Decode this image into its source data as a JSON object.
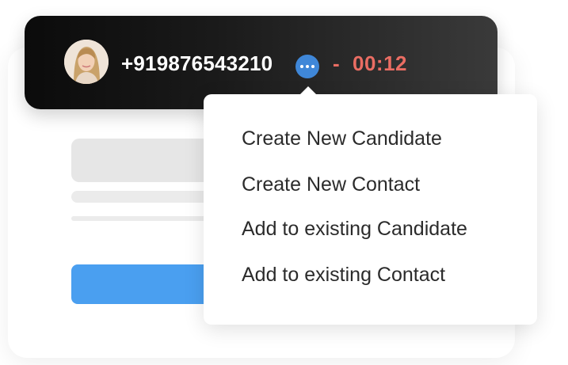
{
  "call": {
    "phone_number": "+919876543210",
    "separator": "-",
    "duration": "00:12",
    "avatar_icon": "user-avatar-photo",
    "more_icon": "more-horizontal-icon"
  },
  "menu": {
    "items": [
      {
        "label": "Create New Candidate"
      },
      {
        "label": "Create New Contact"
      },
      {
        "label": "Add to existing Candidate"
      },
      {
        "label": "Add to existing Contact"
      }
    ]
  },
  "colors": {
    "timer": "#ea6d63",
    "more_button": "#3f87d8",
    "primary_button": "#4a9ff0",
    "bar_dark": "#0b0b0b",
    "bar_light": "#3a3a3a"
  }
}
